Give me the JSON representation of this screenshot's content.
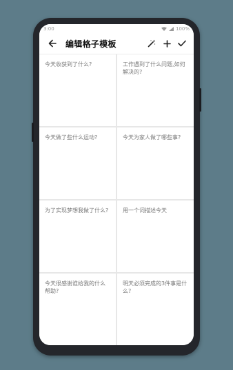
{
  "status": {
    "time": "3:00",
    "battery": "100%"
  },
  "toolbar": {
    "back_icon": "arrow-left-icon",
    "title": "编辑格子模板",
    "actions": [
      "magic-wand-icon",
      "plus-icon",
      "check-icon"
    ]
  },
  "cells": [
    {
      "prompt": "今天收获到了什么?"
    },
    {
      "prompt": "工作遇到了什么问题,如何解决的?"
    },
    {
      "prompt": "今天做了些什么运动?"
    },
    {
      "prompt": "今天为家人做了哪些事?"
    },
    {
      "prompt": "为了实现梦想我做了什么?"
    },
    {
      "prompt": "用一个词描述今天"
    },
    {
      "prompt": "今天很感谢谁给我的什么帮助?"
    },
    {
      "prompt": "明天必须完成的3件事是什么?"
    }
  ],
  "colors": {
    "background": "#5d7c89",
    "phone_frame": "#24262b",
    "screen": "#ffffff",
    "grid_line": "#e7e7e7",
    "hint_text": "#7a7a7a"
  }
}
